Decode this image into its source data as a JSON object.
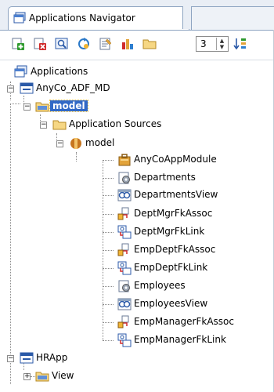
{
  "tab": {
    "title": "Applications Navigator",
    "icon": "applications-navigator-icon"
  },
  "toolbar": {
    "buttons": [
      {
        "name": "new-application-button",
        "icon": "add-icon"
      },
      {
        "name": "delete-button",
        "icon": "delete-icon"
      },
      {
        "name": "search-button",
        "icon": "search-icon"
      },
      {
        "name": "refresh-button",
        "icon": "refresh-icon"
      },
      {
        "name": "properties-button",
        "icon": "properties-icon"
      },
      {
        "name": "chart-button",
        "icon": "chart-icon"
      },
      {
        "name": "folder-button",
        "icon": "folder-icon"
      }
    ],
    "spinner_value": "3",
    "sort_button": "sort-icon"
  },
  "tree": {
    "root": "Applications",
    "app": "AnyCo_ADF_MD",
    "model_folder": "model",
    "app_sources": "Application Sources",
    "model_package": "model",
    "items": [
      "AnyCoAppModule",
      "Departments",
      "DepartmentsView",
      "DeptMgrFkAssoc",
      "DeptMgrFkLink",
      "EmpDeptFkAssoc",
      "EmpDeptFkLink",
      "Employees",
      "EmployeesView",
      "EmpManagerFkAssoc",
      "EmpManagerFkLink"
    ],
    "app2": "HRApp",
    "view_folder": "View"
  },
  "colors": {
    "selection": "#3169c6",
    "tab_border": "#8ea4c1"
  }
}
